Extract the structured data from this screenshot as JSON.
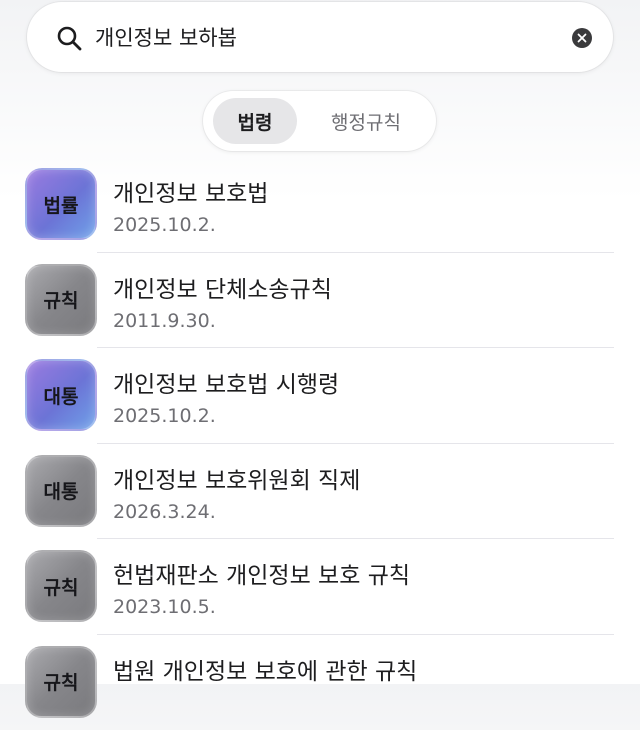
{
  "search": {
    "value": "개인정보 보하봅",
    "placeholder": "검색"
  },
  "tabs": [
    {
      "label": "법령",
      "active": true
    },
    {
      "label": "행정규칙",
      "active": false
    }
  ],
  "results": [
    {
      "badge": "법률",
      "badge_style": "law",
      "title": "개인정보 보호법",
      "date": "2025.10.2."
    },
    {
      "badge": "규칙",
      "badge_style": "gray",
      "title": "개인정보 단체소송규칙",
      "date": "2011.9.30."
    },
    {
      "badge": "대통",
      "badge_style": "law",
      "title": "개인정보 보호법 시행령",
      "date": "2025.10.2."
    },
    {
      "badge": "대통",
      "badge_style": "gray",
      "title": "개인정보 보호위원회 직제",
      "date": "2026.3.24."
    },
    {
      "badge": "규칙",
      "badge_style": "gray",
      "title": "헌법재판소 개인정보 보호 규칙",
      "date": "2023.10.5."
    },
    {
      "badge": "규칙",
      "badge_style": "gray",
      "title": "법원 개인정보 보호에 관한 규칙",
      "date": ""
    }
  ],
  "colors": {
    "accent_law": "#7b78dc",
    "badge_gray": "#8a8a8e",
    "text_primary": "#1d1d1f",
    "text_secondary": "#6e6e73"
  },
  "icons": {
    "search": "magnifier-icon",
    "clear": "clear-icon"
  }
}
